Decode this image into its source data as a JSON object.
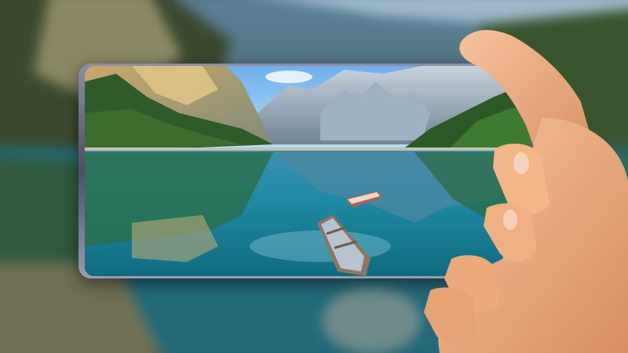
{
  "scene": {
    "subject": "hand-holding-phone",
    "phone_orientation": "landscape",
    "colors": {
      "sky": "#8fc3f0",
      "water": "#1f8fa6",
      "forest": "#2f5a2a",
      "rock": "#8e9aa6",
      "skin": "#f0b48a",
      "phone_frame": "#6e7089"
    }
  }
}
